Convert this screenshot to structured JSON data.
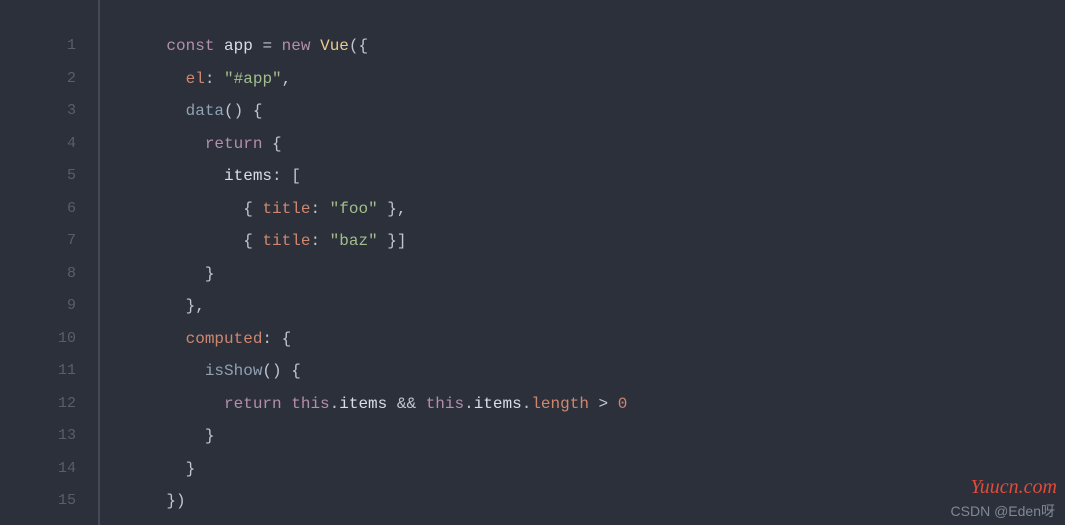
{
  "lines": [
    {
      "num": "1",
      "tokens": [
        [
          "",
          "    "
        ],
        [
          "kw",
          "const"
        ],
        [
          "",
          " "
        ],
        [
          "var",
          "app"
        ],
        [
          "",
          " "
        ],
        [
          "op",
          "="
        ],
        [
          "",
          " "
        ],
        [
          "kw",
          "new"
        ],
        [
          "",
          " "
        ],
        [
          "cls",
          "Vue"
        ],
        [
          "punc",
          "("
        ],
        [
          "punc",
          "{"
        ]
      ]
    },
    {
      "num": "2",
      "tokens": [
        [
          "",
          "      "
        ],
        [
          "prop",
          "el"
        ],
        [
          "punc",
          ":"
        ],
        [
          "",
          " "
        ],
        [
          "str",
          "\"#app\""
        ],
        [
          "punc",
          ","
        ]
      ]
    },
    {
      "num": "3",
      "tokens": [
        [
          "",
          "      "
        ],
        [
          "fn",
          "data"
        ],
        [
          "punc",
          "("
        ],
        [
          "punc",
          ")"
        ],
        [
          "",
          " "
        ],
        [
          "punc",
          "{"
        ]
      ]
    },
    {
      "num": "4",
      "tokens": [
        [
          "",
          "        "
        ],
        [
          "kw",
          "return"
        ],
        [
          "",
          " "
        ],
        [
          "punc",
          "{"
        ]
      ]
    },
    {
      "num": "5",
      "tokens": [
        [
          "",
          "          "
        ],
        [
          "var",
          "items"
        ],
        [
          "punc",
          ":"
        ],
        [
          "",
          " "
        ],
        [
          "punc",
          "["
        ]
      ]
    },
    {
      "num": "6",
      "tokens": [
        [
          "",
          "            "
        ],
        [
          "punc",
          "{"
        ],
        [
          "",
          " "
        ],
        [
          "prop",
          "title"
        ],
        [
          "punc",
          ":"
        ],
        [
          "",
          " "
        ],
        [
          "str",
          "\"foo\""
        ],
        [
          "",
          " "
        ],
        [
          "punc",
          "}"
        ],
        [
          "punc",
          ","
        ]
      ]
    },
    {
      "num": "7",
      "tokens": [
        [
          "",
          "            "
        ],
        [
          "punc",
          "{"
        ],
        [
          "",
          " "
        ],
        [
          "prop",
          "title"
        ],
        [
          "punc",
          ":"
        ],
        [
          "",
          " "
        ],
        [
          "str",
          "\"baz\""
        ],
        [
          "",
          " "
        ],
        [
          "punc",
          "}"
        ],
        [
          "punc",
          "]"
        ]
      ]
    },
    {
      "num": "8",
      "tokens": [
        [
          "",
          "        "
        ],
        [
          "punc",
          "}"
        ]
      ]
    },
    {
      "num": "9",
      "tokens": [
        [
          "",
          "      "
        ],
        [
          "punc",
          "}"
        ],
        [
          "punc",
          ","
        ]
      ]
    },
    {
      "num": "10",
      "tokens": [
        [
          "",
          "      "
        ],
        [
          "prop",
          "computed"
        ],
        [
          "punc",
          ":"
        ],
        [
          "",
          " "
        ],
        [
          "punc",
          "{"
        ]
      ]
    },
    {
      "num": "11",
      "tokens": [
        [
          "",
          "        "
        ],
        [
          "fn",
          "isShow"
        ],
        [
          "punc",
          "("
        ],
        [
          "punc",
          ")"
        ],
        [
          "",
          " "
        ],
        [
          "punc",
          "{"
        ]
      ]
    },
    {
      "num": "12",
      "tokens": [
        [
          "",
          "          "
        ],
        [
          "kw",
          "return"
        ],
        [
          "",
          " "
        ],
        [
          "kw",
          "this"
        ],
        [
          "punc",
          "."
        ],
        [
          "var",
          "items"
        ],
        [
          "",
          " "
        ],
        [
          "op",
          "&&"
        ],
        [
          "",
          " "
        ],
        [
          "kw",
          "this"
        ],
        [
          "punc",
          "."
        ],
        [
          "var",
          "items"
        ],
        [
          "punc",
          "."
        ],
        [
          "prop",
          "length"
        ],
        [
          "",
          " "
        ],
        [
          "op",
          ">"
        ],
        [
          "",
          " "
        ],
        [
          "num",
          "0"
        ]
      ]
    },
    {
      "num": "13",
      "tokens": [
        [
          "",
          "        "
        ],
        [
          "punc",
          "}"
        ]
      ]
    },
    {
      "num": "14",
      "tokens": [
        [
          "",
          "      "
        ],
        [
          "punc",
          "}"
        ]
      ]
    },
    {
      "num": "15",
      "tokens": [
        [
          "",
          "    "
        ],
        [
          "punc",
          "}"
        ],
        [
          "punc",
          ")"
        ]
      ]
    }
  ],
  "attribution": "CSDN @Eden呀",
  "watermark": "Yuucn.com"
}
